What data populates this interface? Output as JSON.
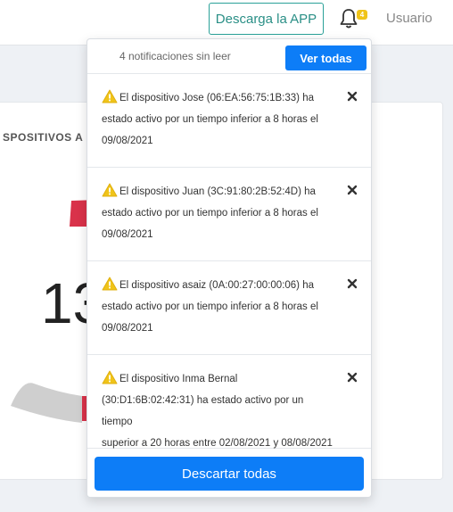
{
  "header": {
    "app_button_label": "Descarga la APP",
    "notification_badge": "4",
    "user_label": "Usuario"
  },
  "background": {
    "card_title": "SPOSITIVOS A",
    "big_number": "13"
  },
  "notifications": {
    "unread_text": "4 notificaciones sin leer",
    "view_all_label": "Ver todas",
    "dismiss_all_label": "Descartar todas",
    "items": [
      {
        "line1": "El dispositivo Jose (06:EA:56:75:1B:33) ha",
        "line2": "estado activo por un tiempo inferior a 8 horas el",
        "line3": "09/08/2021"
      },
      {
        "line1": "El dispositivo Juan (3C:91:80:2B:52:4D) ha",
        "line2": "estado activo por un tiempo inferior a 8 horas el",
        "line3": "09/08/2021"
      },
      {
        "line1": "El dispositivo asaiz (0A:00:27:00:00:06) ha",
        "line2": "estado activo por un tiempo inferior a 8 horas el",
        "line3": "09/08/2021"
      },
      {
        "line1": "El dispositivo Inma Bernal",
        "line2": "(30:D1:6B:02:42:31) ha estado activo por un tiempo",
        "line3": "superior a 20 horas entre 02/08/2021 y 08/08/2021"
      }
    ]
  },
  "colors": {
    "primary": "#0d7df7",
    "warning": "#f0c419",
    "teal": "#2aa198",
    "gauge_red": "#d9324a",
    "gauge_grey": "#cfcfcf"
  }
}
